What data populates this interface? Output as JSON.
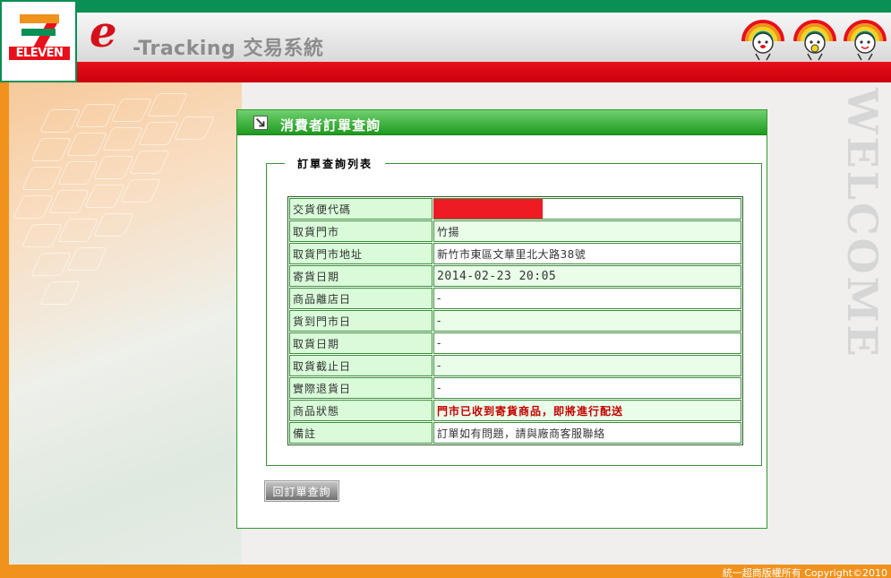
{
  "header": {
    "logo_word": "ELEVEN",
    "brand_e": "e",
    "brand_text": "-Tracking 交易系統"
  },
  "side": {
    "welcome": "WELCOME"
  },
  "panel": {
    "title": "消費者訂單查詢",
    "legend": "訂單查詢列表",
    "rows": [
      {
        "label": "交貨便代碼",
        "value": ""
      },
      {
        "label": "取貨門市",
        "value": "竹揚"
      },
      {
        "label": "取貨門市地址",
        "value": "新竹市東區文華里北大路38號"
      },
      {
        "label": "寄貨日期",
        "value": "2014-02-23 20:05"
      },
      {
        "label": "商品離店日",
        "value": "-"
      },
      {
        "label": "貨到門市日",
        "value": "-"
      },
      {
        "label": "取貨日期",
        "value": "-"
      },
      {
        "label": "取貨截止日",
        "value": "-"
      },
      {
        "label": "實際退貨日",
        "value": "-"
      },
      {
        "label": "商品狀態",
        "value": "門市已收到寄貨商品，即將進行配送"
      },
      {
        "label": "備註",
        "value": "訂單如有問題，請與廠商客服聯絡"
      }
    ],
    "back_button": "回訂單查詢"
  },
  "footer": {
    "copyright": "統一超商版權所有 Copyright©2010"
  },
  "colors": {
    "brand_green": "#0a8f54",
    "brand_red": "#e8101a",
    "brand_orange": "#f0921c",
    "status_red": "#c30000"
  }
}
